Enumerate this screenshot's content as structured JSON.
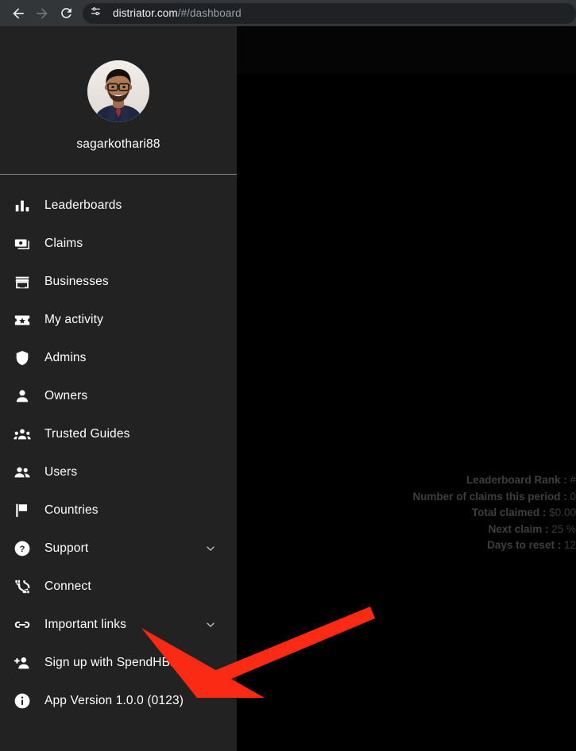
{
  "browser": {
    "back_icon": "back-arrow-icon",
    "forward_icon": "forward-arrow-icon",
    "reload_icon": "reload-icon",
    "site_settings_icon": "site-settings-sliders-icon",
    "url_host": "distriator.com",
    "url_path": "/#/dashboard",
    "url_full": "distriator.com/#/dashboard"
  },
  "sidebar": {
    "avatar_alt": "user-avatar",
    "username": "sagarkothari88",
    "items": [
      {
        "label": "Leaderboards",
        "icon": "bar-chart-icon",
        "expandable": false
      },
      {
        "label": "Claims",
        "icon": "banknote-icon",
        "expandable": false
      },
      {
        "label": "Businesses",
        "icon": "storefront-icon",
        "expandable": false
      },
      {
        "label": "My activity",
        "icon": "ticket-star-icon",
        "expandable": false
      },
      {
        "label": "Admins",
        "icon": "shield-icon",
        "expandable": false
      },
      {
        "label": "Owners",
        "icon": "person-icon",
        "expandable": false
      },
      {
        "label": "Trusted Guides",
        "icon": "group-three-icon",
        "expandable": false
      },
      {
        "label": "Users",
        "icon": "group-two-icon",
        "expandable": false
      },
      {
        "label": "Countries",
        "icon": "flag-icon",
        "expandable": false
      },
      {
        "label": "Support",
        "icon": "help-circle-icon",
        "expandable": true
      },
      {
        "label": "Connect",
        "icon": "cable-plug-icon",
        "expandable": false
      },
      {
        "label": "Important links",
        "icon": "link-icon",
        "expandable": true
      },
      {
        "label": "Sign up with SpendHBD",
        "icon": "person-add-icon",
        "expandable": false
      },
      {
        "label": "App Version 1.0.0 (0123)",
        "icon": "info-circle-icon",
        "expandable": false
      }
    ]
  },
  "main": {
    "stats": [
      {
        "label": "Leaderboard Rank :",
        "value": "#"
      },
      {
        "label": "Number of claims this period :",
        "value": "0"
      },
      {
        "label": "Total claimed :",
        "value": "$0.00"
      },
      {
        "label": "Next claim :",
        "value": "25 %"
      },
      {
        "label": "Days to reset :",
        "value": "12"
      }
    ]
  },
  "annotation": {
    "arrow_color": "#FA2A14",
    "arrow_points_to": "App Version 1.0.0 (0123)"
  },
  "colors": {
    "sidebar_bg": "#222222",
    "main_bg": "#000000",
    "chrome_bg": "#323639",
    "omnibox_bg": "#202124",
    "text_primary": "#ffffff",
    "text_muted": "#9aa0a6",
    "stat_text": "#3f3f3f",
    "arrow": "#FA2A14"
  }
}
